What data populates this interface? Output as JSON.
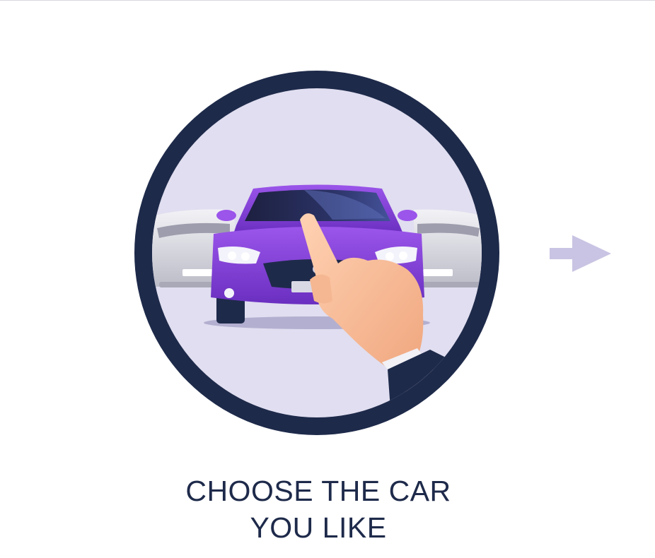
{
  "step": {
    "caption_line_1": "CHOOSE THE CAR",
    "caption_line_2": "YOU LIKE",
    "illustration_icon": "hand-pointing-at-car-icon",
    "next_icon": "arrow-right-icon"
  },
  "colors": {
    "ring": "#1e2a4a",
    "disc_background": "#e0def0",
    "car_body": "#8a45dc",
    "arrow": "#c9c4e3",
    "caption": "#1e2a4a"
  }
}
